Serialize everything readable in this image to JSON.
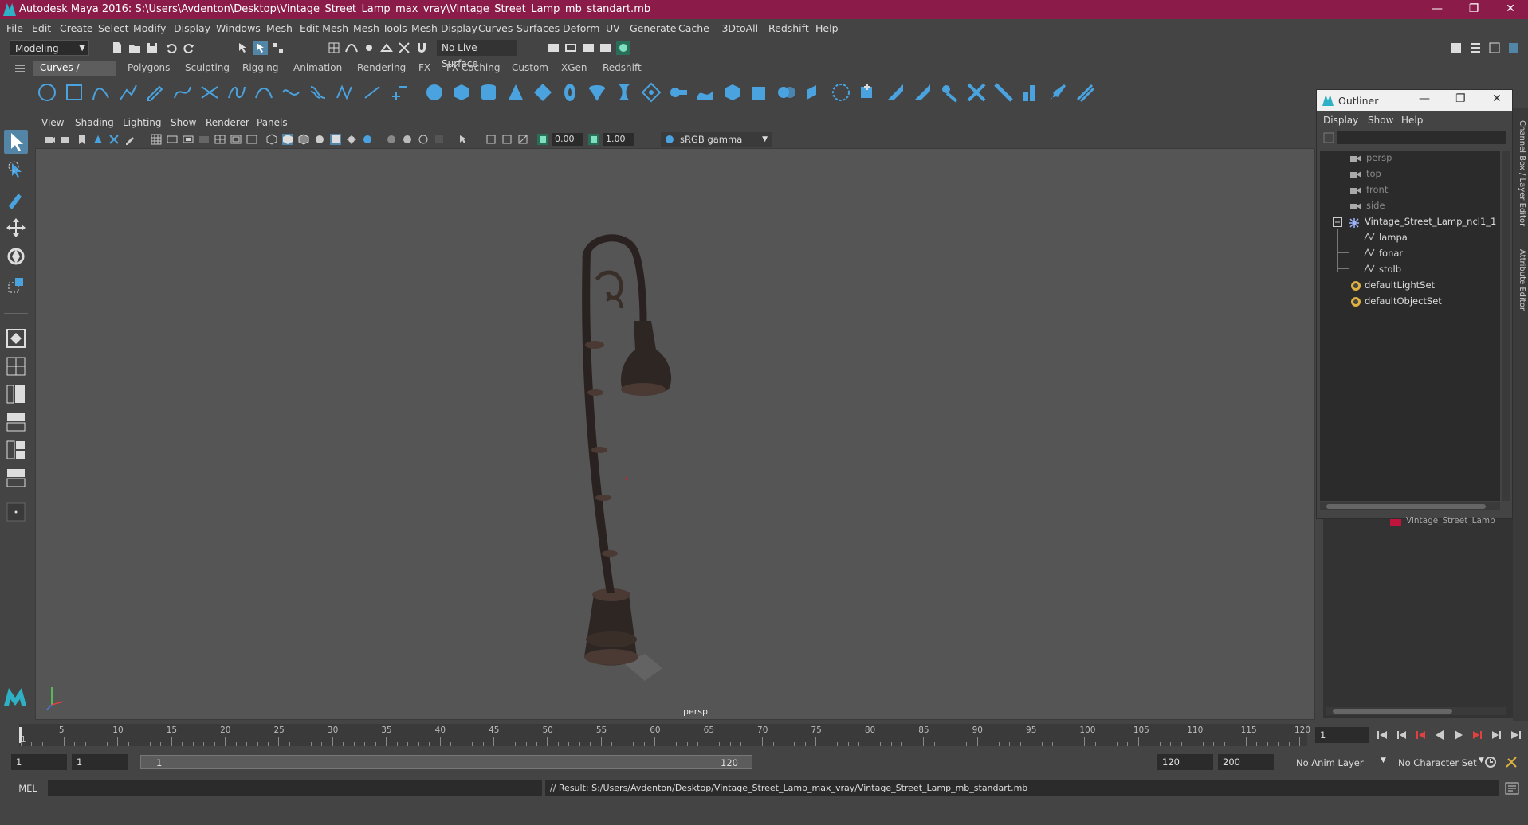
{
  "window": {
    "title": "Autodesk Maya 2016: S:\\Users\\Avdenton\\Desktop\\Vintage_Street_Lamp_max_vray\\Vintage_Street_Lamp_mb_standart.mb",
    "minimize": "—",
    "maximize": "❐",
    "close": "✕"
  },
  "menubar": [
    "File",
    "Edit",
    "Create",
    "Select",
    "Modify",
    "Display",
    "Windows",
    "Mesh",
    "Edit Mesh",
    "Mesh Tools",
    "Mesh Display",
    "Curves",
    "Surfaces",
    "Deform",
    "UV",
    "Generate",
    "Cache",
    "- 3DtoAll -",
    "Redshift",
    "Help"
  ],
  "statusline": {
    "mode": "Modeling",
    "live_surface": "No Live Surface"
  },
  "shelf_tabs": [
    "Curves / Surfaces",
    "Polygons",
    "Sculpting",
    "Rigging",
    "Animation",
    "Rendering",
    "FX",
    "FX Caching",
    "Custom",
    "XGen",
    "Redshift"
  ],
  "shelf_active": "Curves / Surfaces",
  "panel": {
    "menus": [
      "View",
      "Shading",
      "Lighting",
      "Show",
      "Renderer",
      "Panels"
    ],
    "exposure": "0.00",
    "gamma_value": "1.00",
    "color_space": "sRGB gamma",
    "camera": "persp"
  },
  "outliner": {
    "title": "Outliner",
    "menus": [
      "Display",
      "Show",
      "Help"
    ],
    "items": [
      {
        "label": "persp",
        "type": "camera",
        "dim": true
      },
      {
        "label": "top",
        "type": "camera",
        "dim": true
      },
      {
        "label": "front",
        "type": "camera",
        "dim": true
      },
      {
        "label": "side",
        "type": "camera",
        "dim": true
      },
      {
        "label": "Vintage_Street_Lamp_ncl1_1",
        "type": "group",
        "dim": false
      },
      {
        "label": "lampa",
        "type": "mesh",
        "dim": false
      },
      {
        "label": "fonar",
        "type": "mesh",
        "dim": false
      },
      {
        "label": "stolb",
        "type": "mesh",
        "dim": false
      },
      {
        "label": "defaultLightSet",
        "type": "set",
        "dim": false
      },
      {
        "label": "defaultObjectSet",
        "type": "set",
        "dim": false
      }
    ]
  },
  "layer_editor": {
    "layer_name": "Vintage_Street_Lamp",
    "layer_color": "#c0143c"
  },
  "side_tabs": [
    "Channel Box / Layer Editor",
    "Attribute Editor"
  ],
  "timeline": {
    "ticks": [
      5,
      10,
      15,
      20,
      25,
      30,
      35,
      40,
      45,
      50,
      55,
      60,
      65,
      70,
      75,
      80,
      85,
      90,
      95,
      100,
      105,
      110,
      115,
      120
    ],
    "start_label": "1",
    "current_frame": "1"
  },
  "range": {
    "start": "1",
    "playback_start": "1",
    "range_start_label": "1",
    "range_end_label": "120",
    "playback_end": "120",
    "end": "200",
    "anim_layer": "No Anim Layer",
    "character_set": "No Character Set"
  },
  "commandline": {
    "language": "MEL",
    "result": "// Result: S:/Users/Avdenton/Desktop/Vintage_Street_Lamp_max_vray/Vintage_Street_Lamp_mb_standart.mb"
  },
  "colors": {
    "titlebar": "#8b1c4a",
    "accent": "#5285a6",
    "shelf_icon": "#4aa3df"
  }
}
